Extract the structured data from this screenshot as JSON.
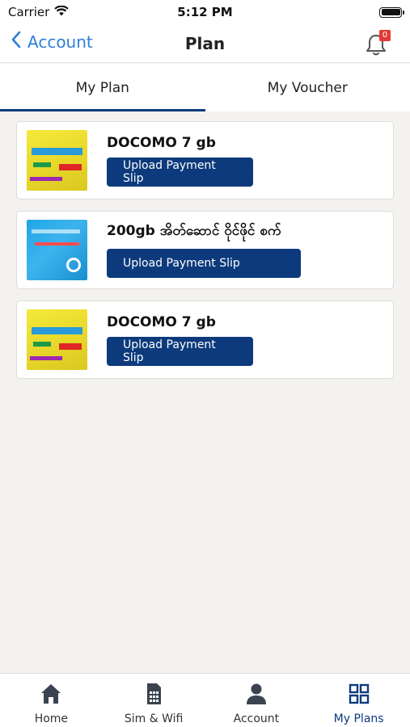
{
  "status_bar": {
    "carrier": "Carrier",
    "time": "5:12 PM"
  },
  "nav": {
    "back_label": "Account",
    "title": "Plan",
    "notification_count": "0"
  },
  "tabs": [
    {
      "label": "My Plan",
      "active": true
    },
    {
      "label": "My Voucher",
      "active": false
    }
  ],
  "plans": [
    {
      "name": "DOCOMO 7 gb",
      "button_label": "Upload Payment Slip",
      "image_icon": "docomo-plan-image"
    },
    {
      "name": "200gb အိတ်ဆောင် ဝိုင်ဖိုင် စက်",
      "button_label": "Upload Payment Slip",
      "image_icon": "pocket-wifi-plan-image"
    },
    {
      "name": "DOCOMO 7 gb",
      "button_label": "Upload Payment Slip",
      "image_icon": "docomo-plan-image"
    }
  ],
  "bottom_nav": [
    {
      "label": "Home",
      "icon": "home-icon",
      "active": false
    },
    {
      "label": "Sim & Wifi",
      "icon": "sim-card-icon",
      "active": false
    },
    {
      "label": "Account",
      "icon": "user-icon",
      "active": false
    },
    {
      "label": "My Plans",
      "icon": "grid-icon",
      "active": true
    }
  ],
  "colors": {
    "accent": "#0d3a7c",
    "link": "#2f7fd8",
    "badge": "#e53935",
    "background": "#f4f2ef"
  }
}
